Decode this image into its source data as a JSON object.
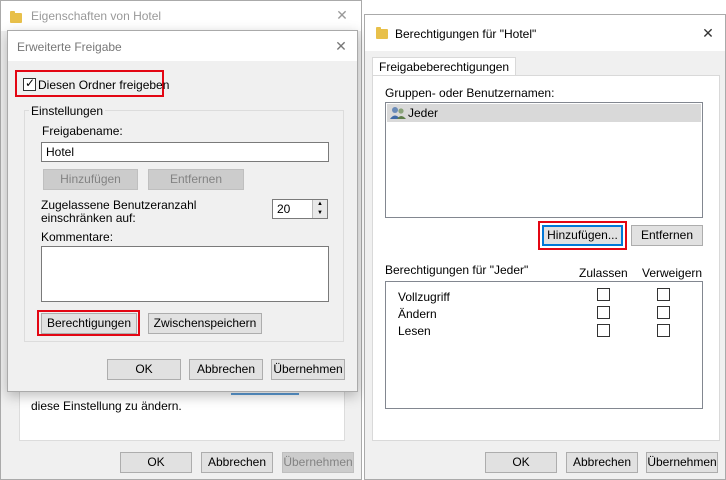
{
  "props_window": {
    "title": "Eigenschaften von Hotel",
    "close": "✕",
    "hint_text": "diese Einstellung zu ändern.",
    "ok": "OK",
    "cancel": "Abbrechen",
    "apply": "Übernehmen"
  },
  "advanced_dialog": {
    "title": "Erweiterte Freigabe",
    "close": "✕",
    "share_checkbox_label": "Diesen Ordner freigeben",
    "share_checked": true,
    "settings_group": "Einstellungen",
    "share_name_label": "Freigabename:",
    "share_name_value": "Hotel",
    "add_button": "Hinzufügen",
    "remove_button": "Entfernen",
    "user_limit_label": "Zugelassene Benutzeranzahl einschränken auf:",
    "user_limit_value": "20",
    "comments_label": "Kommentare:",
    "comments_value": "",
    "permissions_button": "Berechtigungen",
    "caching_button": "Zwischenspeichern",
    "ok": "OK",
    "cancel": "Abbrechen",
    "apply": "Übernehmen"
  },
  "permissions_window": {
    "title": "Berechtigungen für \"Hotel\"",
    "close": "✕",
    "tab": "Freigabeberechtigungen",
    "groups_label": "Gruppen- oder Benutzernamen:",
    "groups": [
      {
        "name": "Jeder",
        "icon": "users-icon"
      }
    ],
    "add_button": "Hinzufügen...",
    "remove_button": "Entfernen",
    "perm_for_label": "Berechtigungen für \"Jeder\"",
    "allow_header": "Zulassen",
    "deny_header": "Verweigern",
    "permissions": [
      {
        "name": "Vollzugriff",
        "allow": false,
        "deny": false
      },
      {
        "name": "Ändern",
        "allow": false,
        "deny": false
      },
      {
        "name": "Lesen",
        "allow": false,
        "deny": false
      }
    ],
    "ok": "OK",
    "cancel": "Abbrechen",
    "apply": "Übernehmen"
  }
}
